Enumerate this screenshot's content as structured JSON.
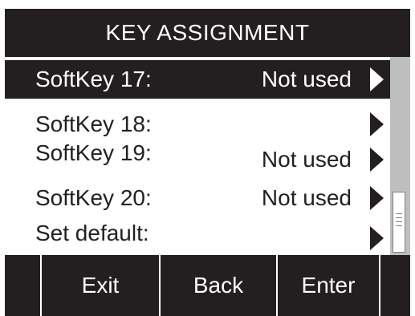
{
  "title": "KEY ASSIGNMENT",
  "rows": [
    {
      "label": "SoftKey 17:",
      "value": "Not used"
    },
    {
      "label": "SoftKey 18:",
      "value": ""
    },
    {
      "label": "SoftKey 19:",
      "value": "Not used"
    },
    {
      "label": "SoftKey 20:",
      "value": "Not used"
    },
    {
      "label": "Set default:",
      "value": ""
    }
  ],
  "softkeys": {
    "exit": "Exit",
    "back": "Back",
    "enter": "Enter"
  },
  "colors": {
    "screen_bg": "#231f20",
    "list_bg": "#ffffff",
    "scrollbar_track": "#bcbec0"
  },
  "icons": {
    "row_arrow": "triangle-right-icon",
    "scroll_grip": "grip-lines-icon"
  }
}
